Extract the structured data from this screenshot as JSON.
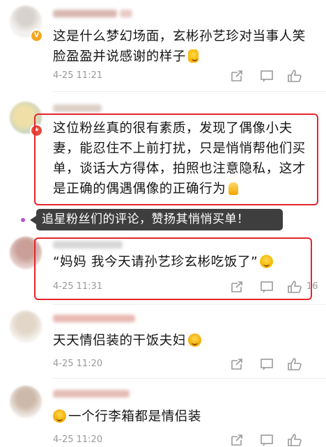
{
  "comments": [
    {
      "text": "这是什么梦幻场面，玄彬孙艺珍对当事人笑脸盈盈并说感谢的样子",
      "time": "4-25 11:21",
      "likes": "",
      "emoji": "doll-emoji"
    },
    {
      "text": "这位粉丝真的很有素质，发现了偶像小夫妻，能忍住不上前打扰，只是悄悄帮他们买单，谈话大方得体，拍照也注意隐私，这才是正确的偶遇偶像的正确行为",
      "time": "",
      "likes": "",
      "emoji": "thumbs-up-emoji"
    },
    {
      "text": "“妈妈 我今天请孙艺珍玄彬吃饭了”",
      "time": "4-25 11:31",
      "likes": "16",
      "emoji": "smile-emoji"
    },
    {
      "text": "天天情侣装的干饭夫妇",
      "time": "4-25 11:20",
      "likes": "",
      "emoji": "cry-emoji"
    },
    {
      "text": "一个行李箱都是情侣装",
      "time": "4-25 11:20",
      "likes": "",
      "emoji": "cry-emoji"
    }
  ],
  "tooltip": "追星粉丝们的评论，赞扬其悄悄买单！",
  "colors": {
    "highlight": "#e4262b",
    "meta": "#9a9a9a"
  }
}
